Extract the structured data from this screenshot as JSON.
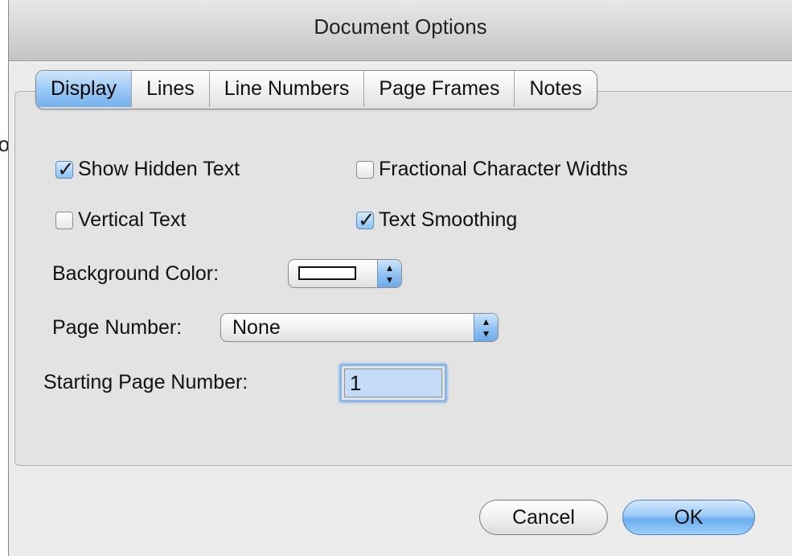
{
  "background_fragment": "o",
  "window": {
    "title": "Document Options"
  },
  "tabs": [
    {
      "label": "Display",
      "active": true
    },
    {
      "label": "Lines",
      "active": false
    },
    {
      "label": "Line Numbers",
      "active": false
    },
    {
      "label": "Page Frames",
      "active": false
    },
    {
      "label": "Notes",
      "active": false
    }
  ],
  "display": {
    "show_hidden_text": {
      "label": "Show Hidden Text",
      "checked": true
    },
    "fractional_character_widths": {
      "label": "Fractional Character Widths",
      "checked": false
    },
    "vertical_text": {
      "label": "Vertical Text",
      "checked": false
    },
    "text_smoothing": {
      "label": "Text Smoothing",
      "checked": true
    },
    "background_color": {
      "label": "Background Color:",
      "value": "#ffffff"
    },
    "page_number": {
      "label": "Page Number:",
      "value": "None"
    },
    "starting_page_number": {
      "label": "Starting Page Number:",
      "value": "1"
    }
  },
  "buttons": {
    "cancel": "Cancel",
    "ok": "OK"
  },
  "colors": {
    "accent": "#74b0ec",
    "window_bg": "#ececec"
  }
}
